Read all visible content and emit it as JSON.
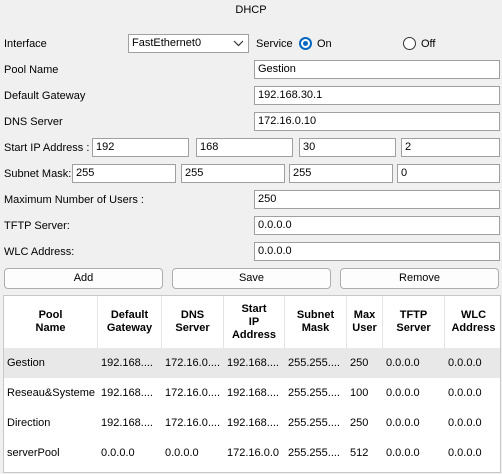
{
  "window": {
    "title": "DHCP"
  },
  "form": {
    "interface_label": "Interface",
    "interface_value": "FastEthernet0",
    "service_label": "Service",
    "service_on_label": "On",
    "service_off_label": "Off",
    "service_selected": "On",
    "pool_name_label": "Pool Name",
    "pool_name_value": "Gestion",
    "default_gateway_label": "Default Gateway",
    "default_gateway_value": "192.168.30.1",
    "dns_server_label": "DNS Server",
    "dns_server_value": "172.16.0.10",
    "start_ip_label": "Start IP Address :",
    "start_ip": [
      "192",
      "168",
      "30",
      "2"
    ],
    "subnet_mask_label": "Subnet Mask:",
    "subnet_mask": [
      "255",
      "255",
      "255",
      "0"
    ],
    "max_users_label": "Maximum Number of Users :",
    "max_users_value": "250",
    "tftp_label": "TFTP Server:",
    "tftp_value": "0.0.0.0",
    "wlc_label": "WLC Address:",
    "wlc_value": "0.0.0.0"
  },
  "buttons": {
    "add": "Add",
    "save": "Save",
    "remove": "Remove"
  },
  "table": {
    "headers": [
      [
        "Pool",
        "Name"
      ],
      [
        "Default",
        "Gateway"
      ],
      [
        "DNS",
        "Server"
      ],
      [
        "Start",
        "IP",
        "Address"
      ],
      [
        "Subnet",
        "Mask"
      ],
      [
        "Max",
        "User"
      ],
      [
        "TFTP",
        "Server"
      ],
      [
        "WLC",
        "Address"
      ]
    ],
    "rows": [
      [
        "Gestion",
        "192.168....",
        "172.16.0....",
        "192.168....",
        "255.255....",
        "250",
        "0.0.0.0",
        "0.0.0.0"
      ],
      [
        "Reseau&Systeme",
        "192.168....",
        "172.16.0....",
        "192.168....",
        "255.255....",
        "100",
        "0.0.0.0",
        "0.0.0.0"
      ],
      [
        "Direction",
        "192.168....",
        "172.16.0....",
        "192.168....",
        "255.255....",
        "250",
        "0.0.0.0",
        "0.0.0.0"
      ],
      [
        "serverPool",
        "0.0.0.0",
        "0.0.0.0",
        "172.16.0.0",
        "255.255....",
        "512",
        "0.0.0.0",
        "0.0.0.0"
      ]
    ]
  },
  "colors": {
    "accent": "#0067c0",
    "selected_row": "#e8e8e8"
  }
}
